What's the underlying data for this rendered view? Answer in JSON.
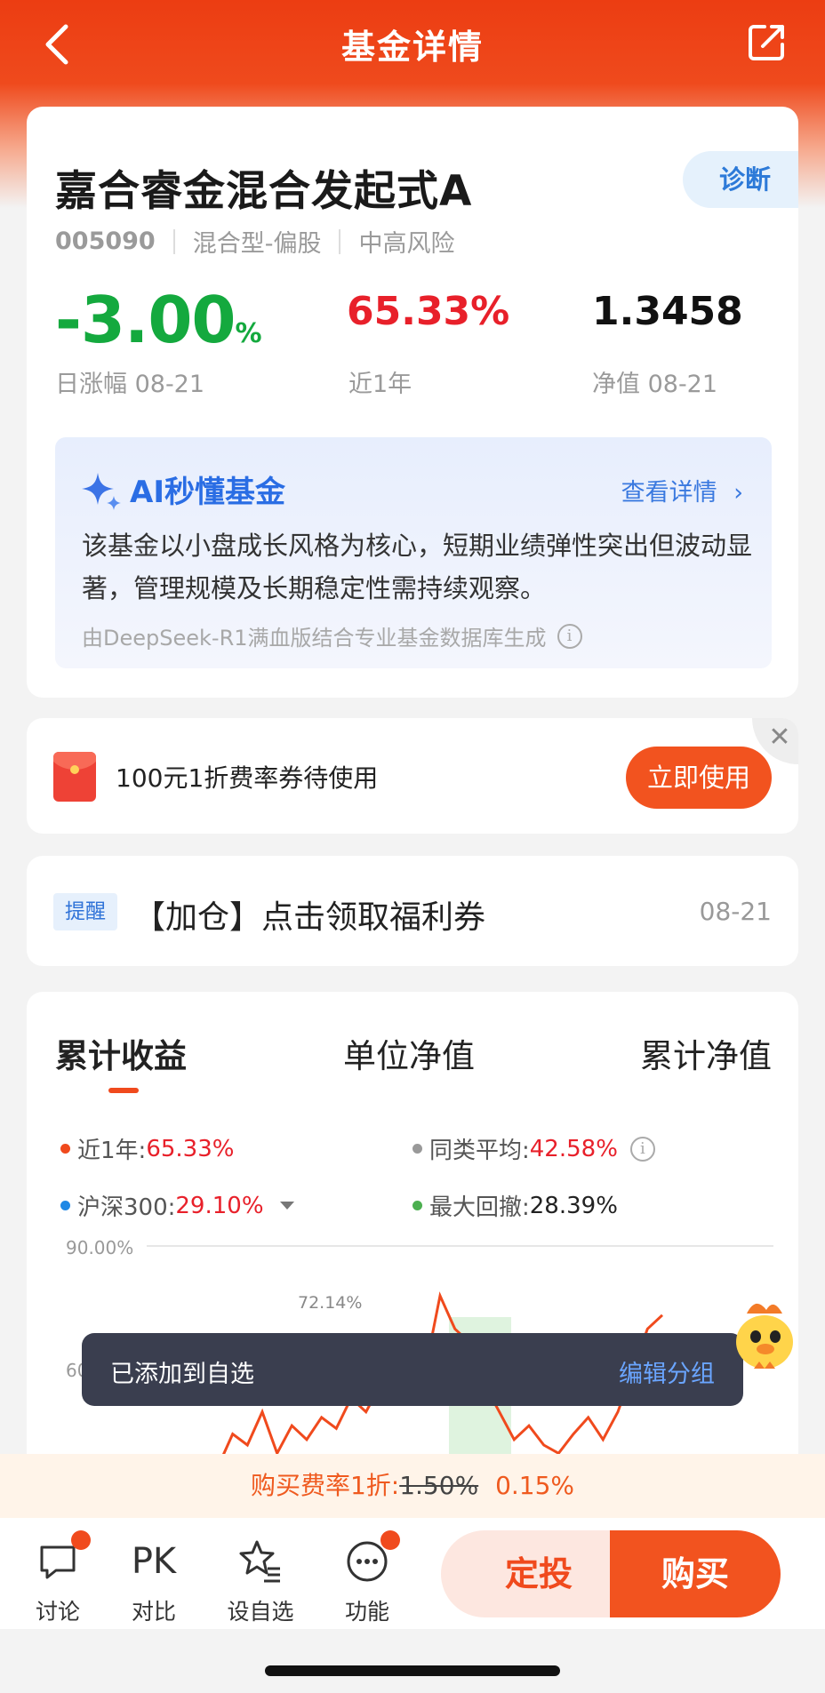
{
  "header": {
    "title": "基金详情"
  },
  "fund": {
    "name": "嘉合睿金混合发起式A",
    "diagnose_label": "诊断",
    "code": "005090",
    "type": "混合型-偏股",
    "risk": "中高风险",
    "daily_change": "-3.00",
    "daily_change_unit": "%",
    "daily_label": "日涨幅 08-21",
    "year_return": "65.33%",
    "year_label": "近1年",
    "nav": "1.3458",
    "nav_label": "净值 08-21"
  },
  "ai": {
    "title": "AI秒懂基金",
    "more": "查看详情",
    "text": "该基金以小盘成长风格为核心，短期业绩弹性突出但波动显著，管理规模及长期稳定性需持续观察。",
    "footer": "由DeepSeek-R1满血版结合专业基金数据库生成"
  },
  "coupon": {
    "text": "100元1折费率券待使用",
    "button": "立即使用",
    "close": "✕"
  },
  "reminder": {
    "tag": "提醒",
    "text": "【加仓】点击领取福利券",
    "date": "08-21"
  },
  "chart": {
    "tabs": [
      "累计收益",
      "单位净值",
      "累计净值"
    ],
    "legend": [
      {
        "label": "近1年:",
        "value": "65.33%",
        "color": "#f04a1d"
      },
      {
        "label": "同类平均:",
        "value": "42.58%",
        "color": "#999999"
      },
      {
        "label": "沪深300:",
        "value": "29.10%",
        "color": "#1e88e5"
      },
      {
        "label": "最大回撤:",
        "value": "28.39%",
        "color": "#4caf50"
      }
    ],
    "y_labels": [
      "90.00%",
      "60."
    ],
    "peak_label": "72.14%"
  },
  "chart_data": {
    "type": "line",
    "ylim_label_top": "90.00%",
    "series": [
      {
        "name": "近1年",
        "values": [
          10,
          22,
          18,
          30,
          15,
          25,
          20,
          28,
          24,
          35,
          30,
          40,
          38,
          50,
          45,
          72,
          60,
          55,
          40,
          30,
          20,
          25,
          18,
          15,
          22,
          28,
          20,
          30,
          45,
          60,
          65
        ]
      }
    ]
  },
  "toast": {
    "text": "已添加到自选",
    "link": "编辑分组"
  },
  "fee": {
    "prefix": "购买费率1折:",
    "old": "1.50%",
    "new": "0.15%"
  },
  "bottom": {
    "items": [
      {
        "label": "讨论",
        "icon": "chat-icon"
      },
      {
        "label": "对比",
        "icon": "PK"
      },
      {
        "label": "设自选",
        "icon": "star-list-icon"
      },
      {
        "label": "功能",
        "icon": "more-icon"
      }
    ],
    "dingtou": "定投",
    "buy": "购买"
  }
}
